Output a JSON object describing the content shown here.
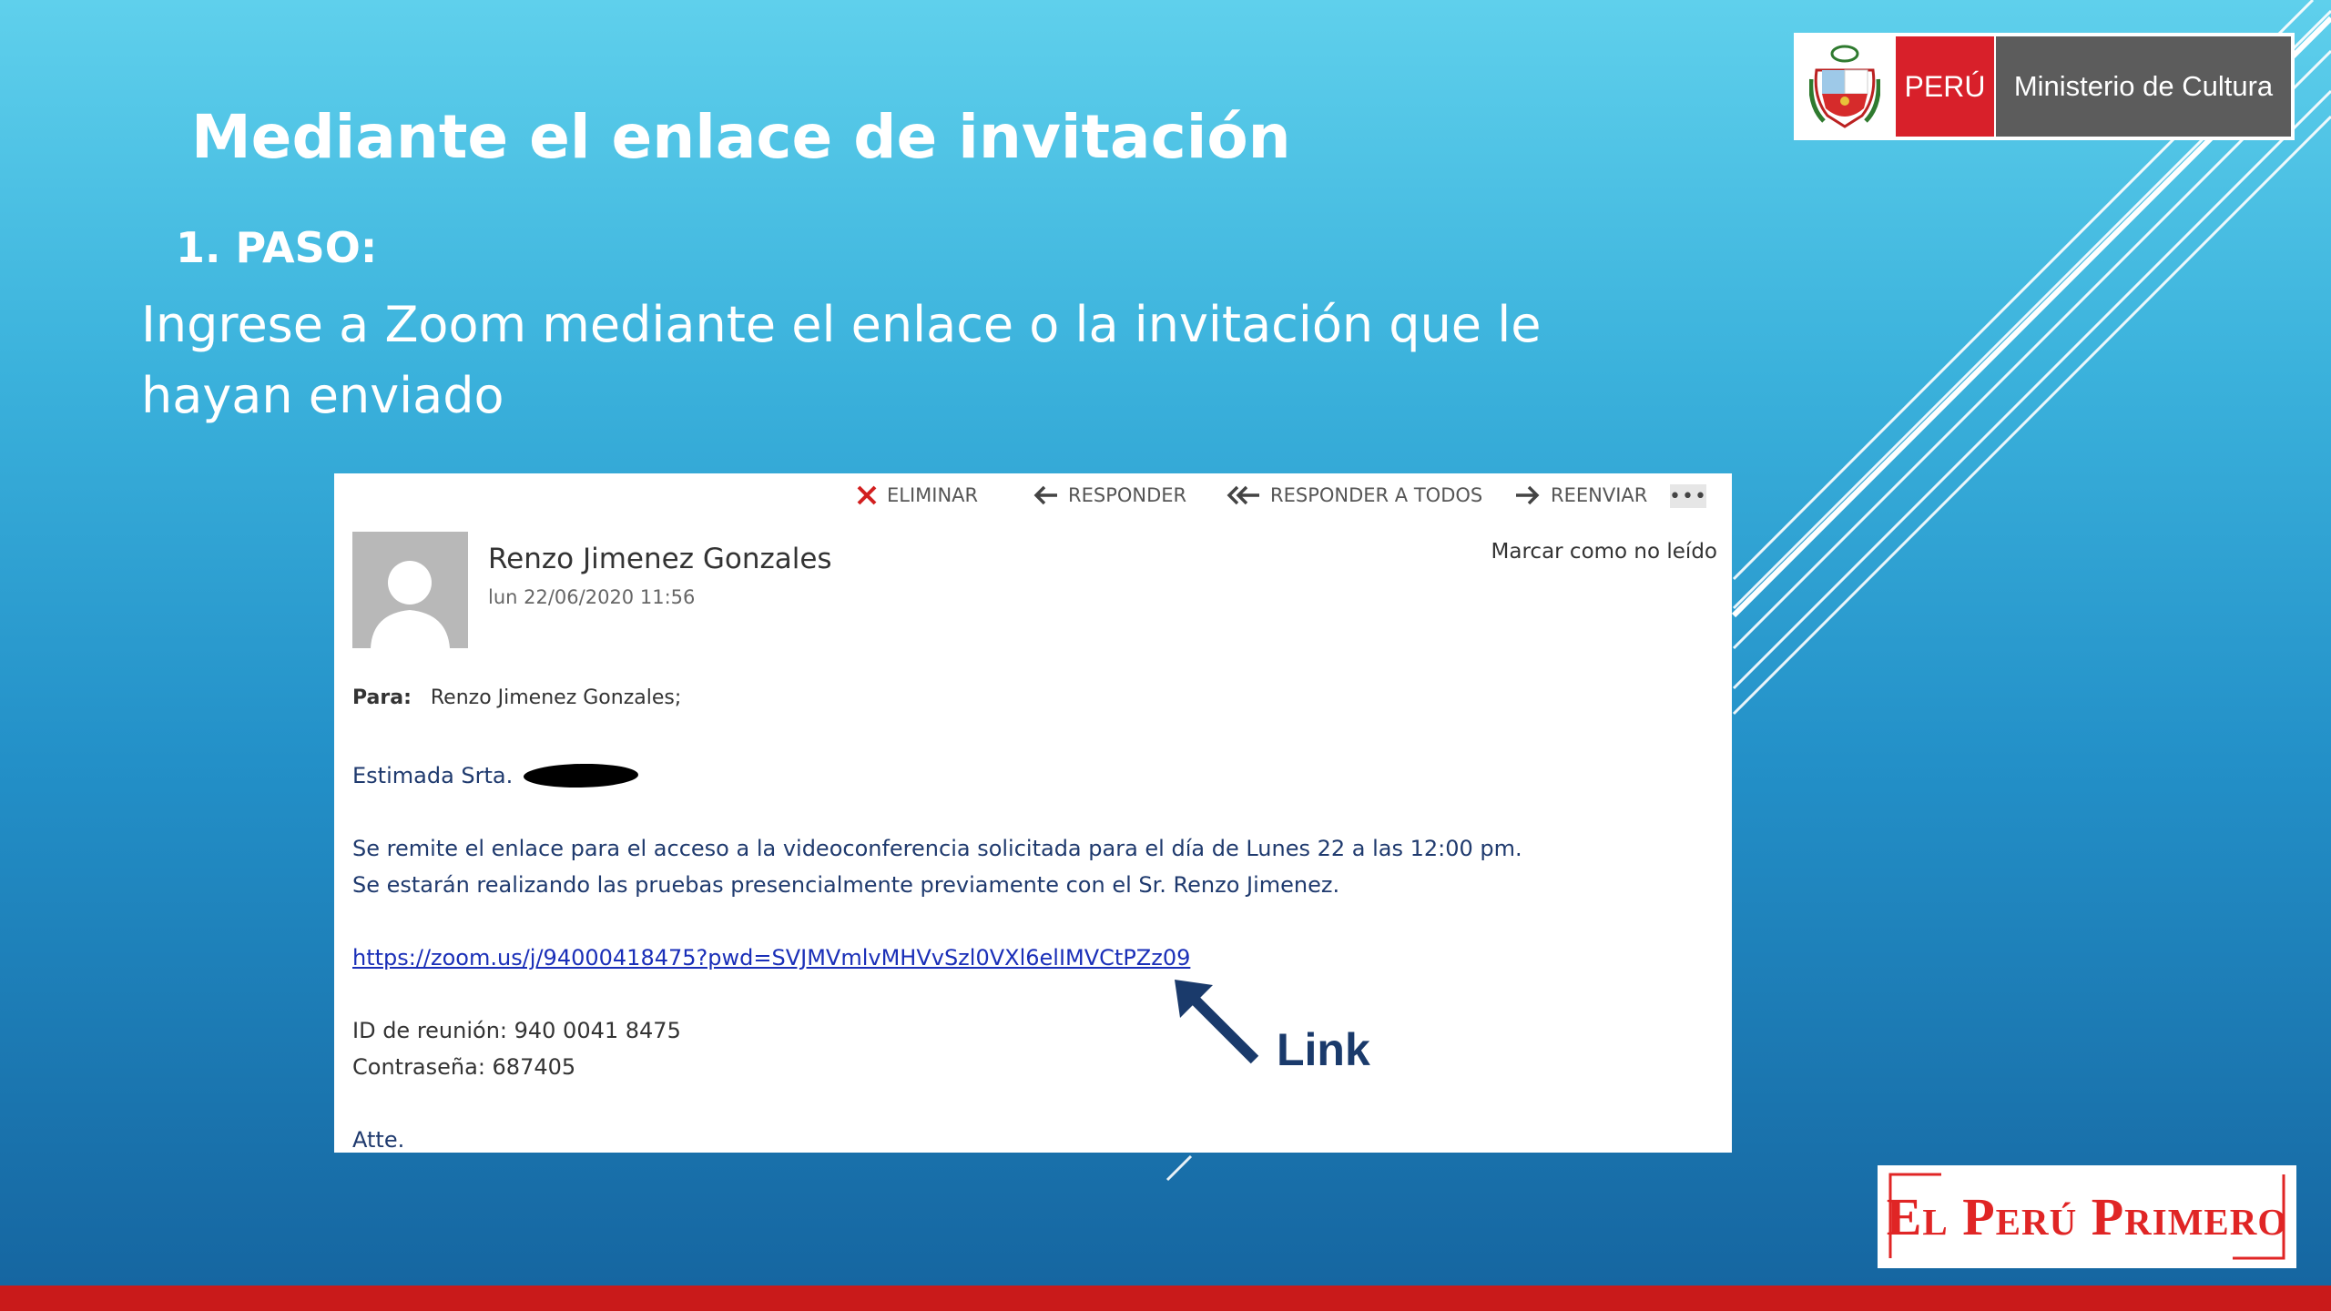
{
  "slide": {
    "title": "Mediante el enlace de invitación",
    "step_label": "1. PASO:",
    "instruction": "Ingrese a Zoom mediante el enlace o la invitación que le hayan enviado"
  },
  "ministry_logo": {
    "country": "PERÚ",
    "ministry": "Ministerio de Cultura",
    "country_color": "#d8202a",
    "ministry_color": "#5c5c5c"
  },
  "email": {
    "toolbar": {
      "delete": "ELIMINAR",
      "reply": "RESPONDER",
      "reply_all": "RESPONDER A TODOS",
      "forward": "REENVIAR",
      "more": "•••"
    },
    "sender": "Renzo Jimenez Gonzales",
    "date": "lun 22/06/2020 11:56",
    "mark_unread": "Marcar como no leído",
    "to_label": "Para:",
    "to_value": "Renzo Jimenez Gonzales;",
    "greeting": "Estimada Srta.",
    "body_line1": "Se remite el  enlace para el acceso a la videoconferencia solicitada para el día de Lunes  22 a las 12:00 pm.",
    "body_line2": "Se estarán  realizando las pruebas presencialmente previamente con el Sr. Renzo Jimenez.",
    "link": "https://zoom.us/j/94000418475?pwd=SVJMVmlvMHVvSzl0VXl6elIMVCtPZz09",
    "meeting_id": "ID de reunión: 940 0041 8475",
    "password": "Contraseña: 687405",
    "signoff": "Atte."
  },
  "annotation": {
    "label": "Link"
  },
  "footer_logo": {
    "text": "El Perú Primero",
    "color": "#e02525"
  },
  "colors": {
    "bottom_bar": "#c91a1a",
    "link": "#1a2fb8"
  }
}
